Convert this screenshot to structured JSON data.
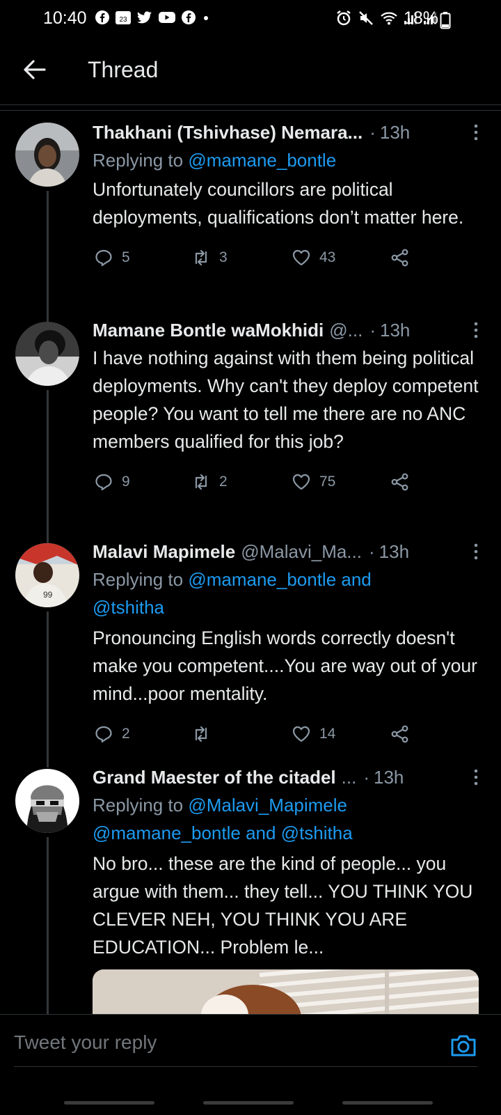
{
  "status_bar": {
    "time": "10:40",
    "calendar_day": "23",
    "battery": "18%"
  },
  "header": {
    "title": "Thread"
  },
  "tweets": [
    {
      "name": "Thakhani (Tshivhase) Nemara...",
      "handle": "",
      "time": "13h",
      "replying_label": "Replying to ",
      "replying_mentions": "@mamane_bontle",
      "replying_line2": "",
      "text": "Unfortunately councillors are political deployments, qualifications don’t matter here.",
      "replies": "5",
      "retweets": "3",
      "likes": "43"
    },
    {
      "name": "Mamane Bontle waMokhidi",
      "handle": "@...",
      "time": "13h",
      "replying_label": "",
      "replying_mentions": "",
      "replying_line2": "",
      "text": "I have nothing against with them being political deployments. Why can't they deploy competent people? You want to tell me there are no ANC members qualified for this job?",
      "replies": "9",
      "retweets": "2",
      "likes": "75"
    },
    {
      "name": "Malavi Mapimele",
      "handle": "@Malavi_Ma...",
      "time": "13h",
      "replying_label": "Replying to ",
      "replying_mentions": "@mamane_bontle and",
      "replying_line2": "@tshitha",
      "text": "Pronouncing English words correctly doesn't make you competent....You are way out of your mind...poor mentality.",
      "replies": "2",
      "retweets": "",
      "likes": "14"
    },
    {
      "name": "Grand Maester of the citadel",
      "handle": "...",
      "time": "13h",
      "replying_label": "Replying to ",
      "replying_mentions": "@Malavi_Mapimele",
      "replying_line2": "@mamane_bontle and @tshitha",
      "text": "No bro... these are the kind of people... you argue with them... they tell... YOU THINK YOU CLEVER NEH, YOU THINK YOU ARE EDUCATION... Problem le...",
      "replies": "",
      "retweets": "",
      "likes": ""
    }
  ],
  "reply_bar": {
    "placeholder": "Tweet your reply"
  },
  "colors": {
    "background": "#000000",
    "accent": "#1d9bf0",
    "secondary_text": "#8b98a5"
  }
}
